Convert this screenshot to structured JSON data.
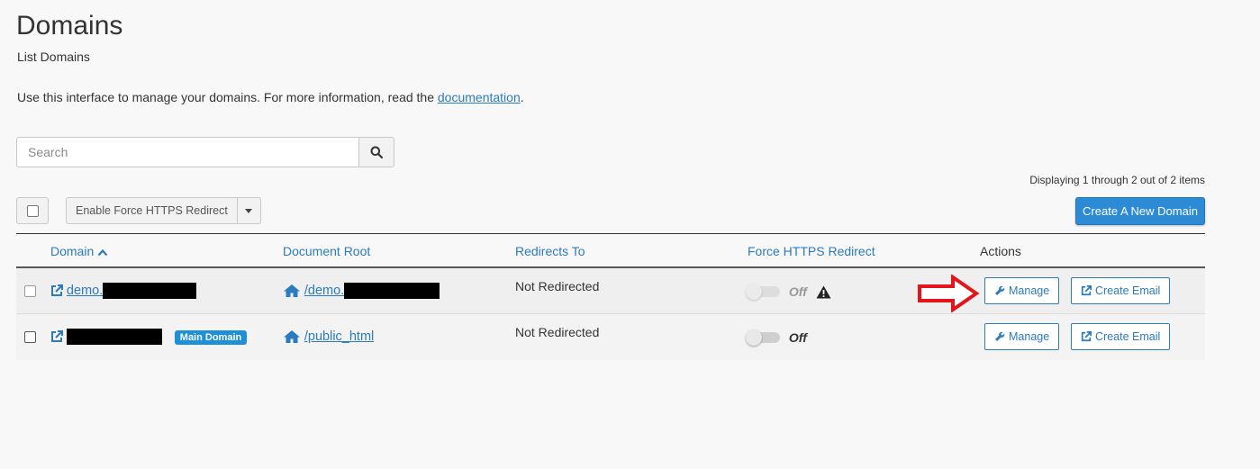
{
  "page": {
    "title": "Domains",
    "subtitle": "List Domains",
    "intro_text": "Use this interface to manage your domains. For more information, read the ",
    "intro_link": "documentation",
    "intro_end": "."
  },
  "search": {
    "placeholder": "Search",
    "value": ""
  },
  "pagination": {
    "displaying": "Displaying 1 through 2 out of 2 items"
  },
  "toolbar": {
    "bulk_action_label": "Enable Force HTTPS Redirect",
    "create_label": "Create A New Domain"
  },
  "table": {
    "headers": {
      "domain": "Domain",
      "document_root": "Document Root",
      "redirects_to": "Redirects To",
      "force_https": "Force HTTPS Redirect",
      "actions": "Actions"
    },
    "rows": [
      {
        "domain": "demo.",
        "main_badge": "",
        "document_root": "/demo.",
        "redirects_to": "Not Redirected",
        "force_https": "Off",
        "manage_label": "Manage",
        "email_label": "Create Email"
      },
      {
        "domain": "",
        "main_badge": "Main Domain",
        "document_root": "/public_html",
        "redirects_to": "Not Redirected",
        "force_https": "Off",
        "manage_label": "Manage",
        "email_label": "Create Email"
      }
    ]
  },
  "colors": {
    "accent": "#2a7bbf",
    "primary_button": "#2d8ad4",
    "badge": "#1f8fd6",
    "annotation_arrow": "#e5141b"
  }
}
